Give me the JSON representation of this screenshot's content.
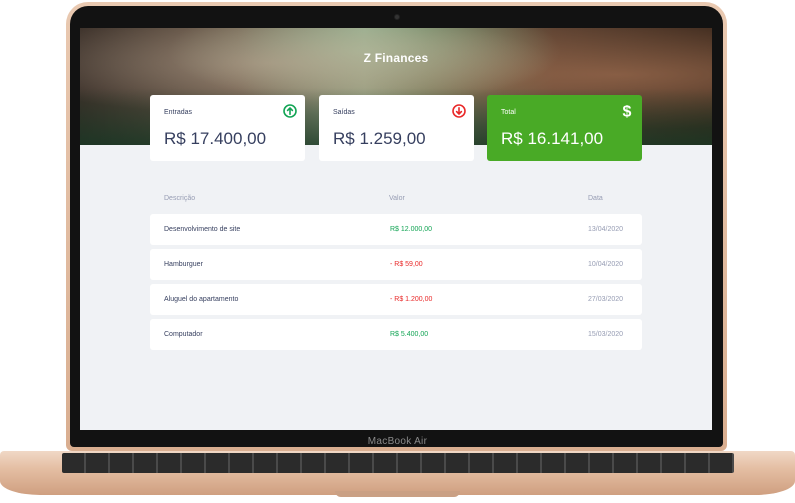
{
  "device": {
    "label": "MacBook Air"
  },
  "app": {
    "title": "Z Finances"
  },
  "cards": {
    "income": {
      "label": "Entradas",
      "value": "R$ 17.400,00",
      "icon": "arrow-up-circle-icon",
      "icon_color": "#12a454"
    },
    "expense": {
      "label": "Saídas",
      "value": "R$ 1.259,00",
      "icon": "arrow-down-circle-icon",
      "icon_color": "#e92929"
    },
    "total": {
      "label": "Total",
      "value": "R$ 16.141,00",
      "icon": "dollar-sign-icon",
      "bg_color": "#49aa26"
    }
  },
  "table": {
    "headers": [
      "Descrição",
      "Valor",
      "Data"
    ],
    "rows": [
      {
        "description": "Desenvolvimento de site",
        "amount": "R$ 12.000,00",
        "date": "13/04/2020",
        "type": "income"
      },
      {
        "description": "Hamburguer",
        "amount": "- R$ 59,00",
        "date": "10/04/2020",
        "type": "expense"
      },
      {
        "description": "Aluguel do apartamento",
        "amount": "- R$ 1.200,00",
        "date": "27/03/2020",
        "type": "expense"
      },
      {
        "description": "Computador",
        "amount": "R$ 5.400,00",
        "date": "15/03/2020",
        "type": "income"
      }
    ]
  },
  "colors": {
    "income": "#12a454",
    "expense": "#e92929",
    "text": "#363f5f",
    "muted": "#969cb3",
    "background": "#f0f2f5"
  }
}
